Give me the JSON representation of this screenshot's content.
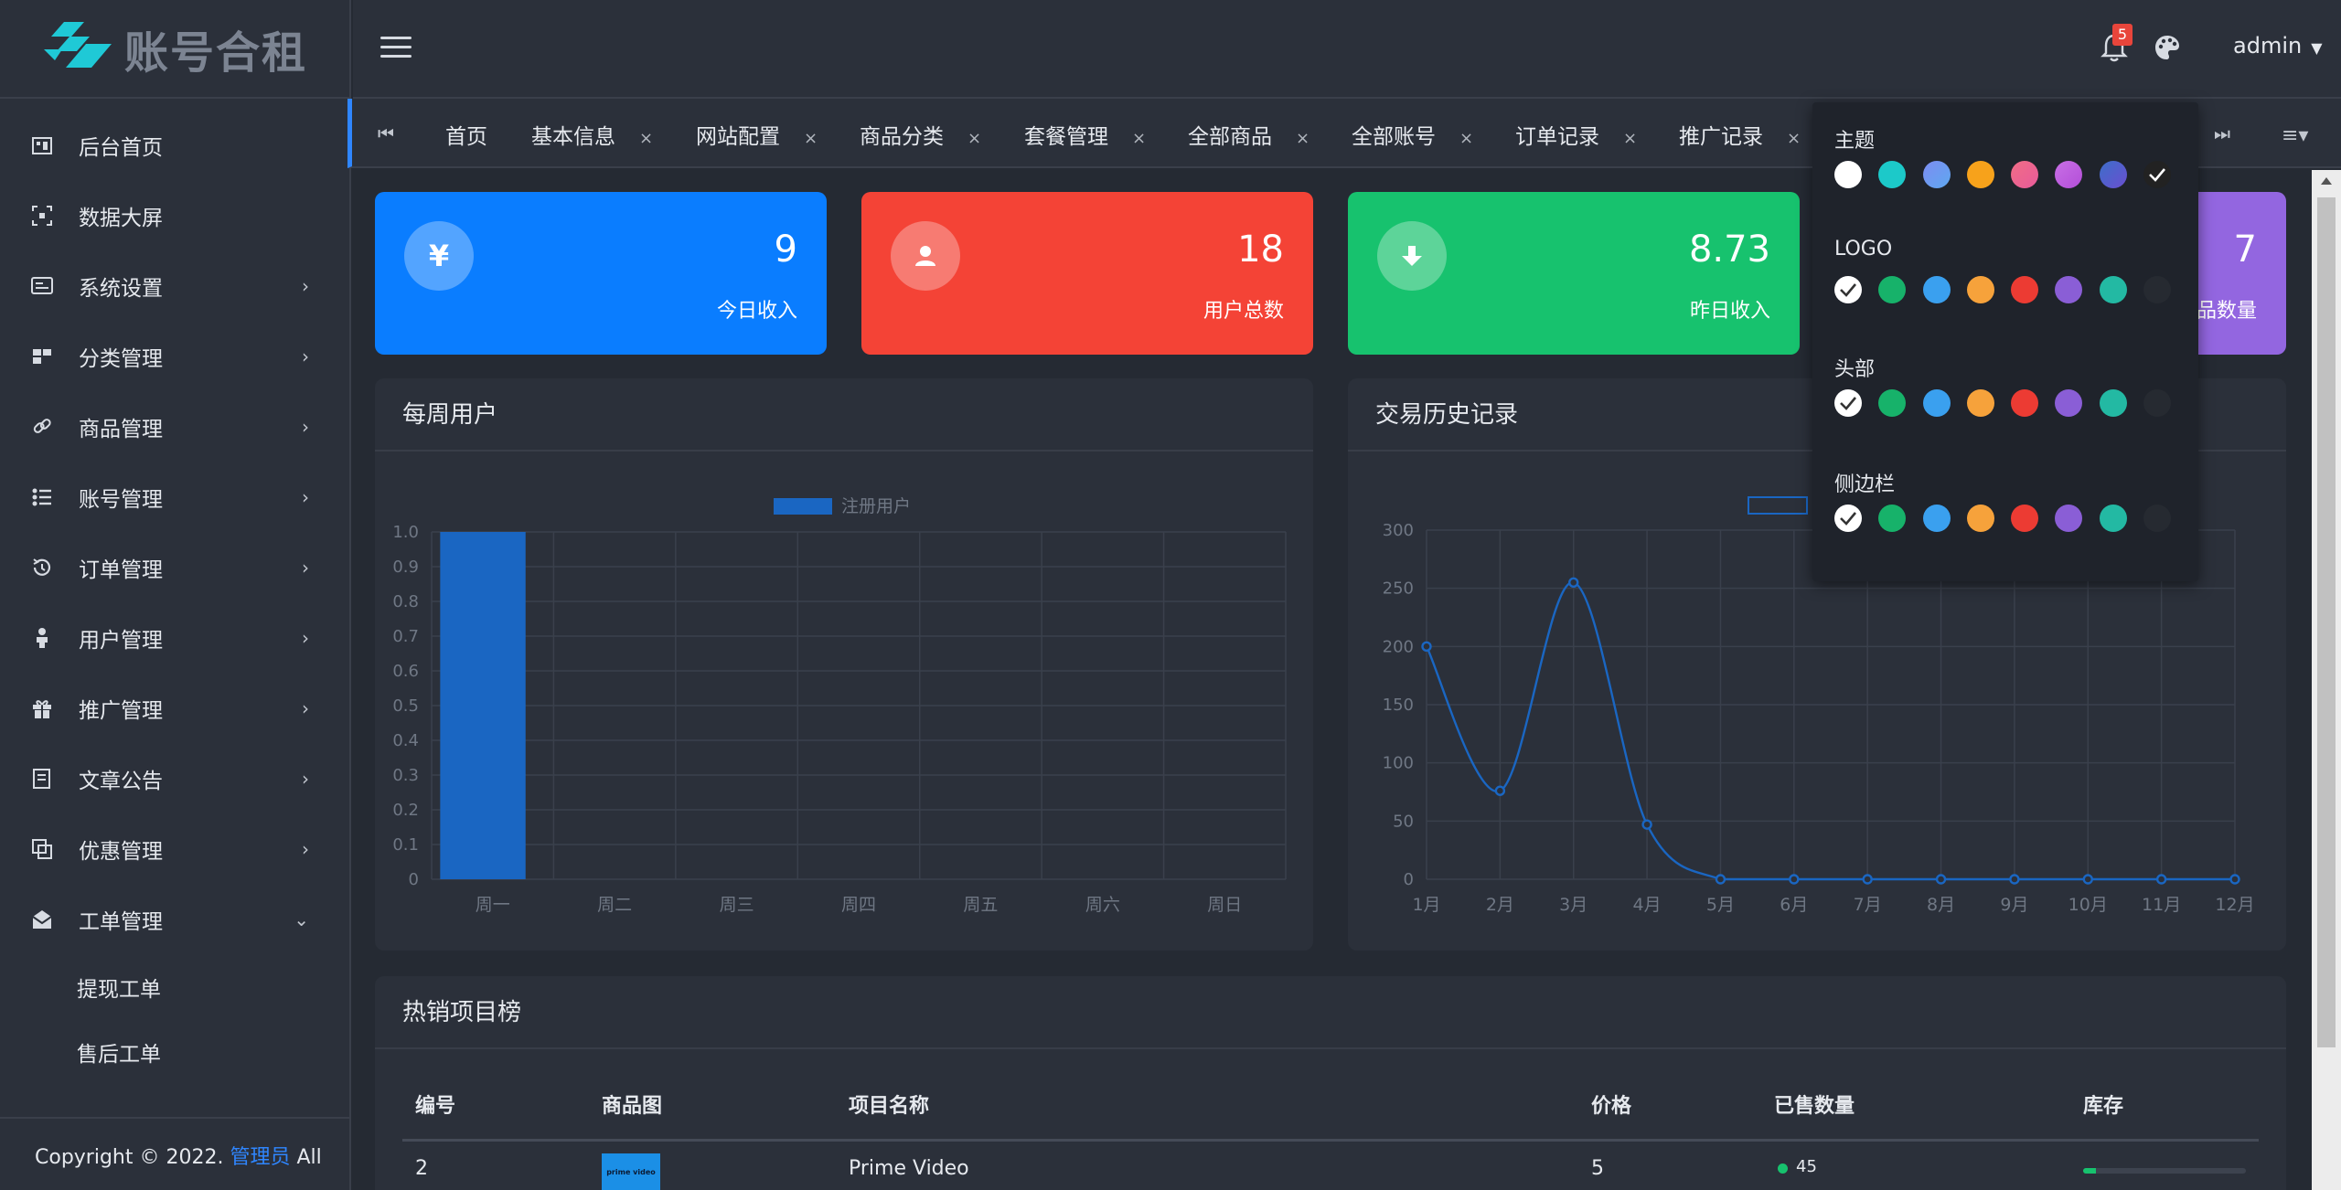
{
  "app": {
    "logo_text": "账号合租"
  },
  "sidebar": {
    "items": [
      {
        "label": "后台首页",
        "icon": "dashboard-icon",
        "arrow": ""
      },
      {
        "label": "数据大屏",
        "icon": "screen-icon",
        "arrow": ""
      },
      {
        "label": "系统设置",
        "icon": "settings-icon",
        "arrow": "›"
      },
      {
        "label": "分类管理",
        "icon": "category-icon",
        "arrow": "›"
      },
      {
        "label": "商品管理",
        "icon": "link-icon",
        "arrow": "›"
      },
      {
        "label": "账号管理",
        "icon": "list-icon",
        "arrow": "›"
      },
      {
        "label": "订单管理",
        "icon": "history-icon",
        "arrow": "›"
      },
      {
        "label": "用户管理",
        "icon": "user-icon",
        "arrow": "›"
      },
      {
        "label": "推广管理",
        "icon": "gift-icon",
        "arrow": "›"
      },
      {
        "label": "文章公告",
        "icon": "article-icon",
        "arrow": "›"
      },
      {
        "label": "优惠管理",
        "icon": "coupon-icon",
        "arrow": "›"
      },
      {
        "label": "工单管理",
        "icon": "mail-icon",
        "arrow": "⌄"
      }
    ],
    "subitems": [
      "提现工单",
      "售后工单"
    ],
    "copyright_prefix": "Copyright © 2022.",
    "copyright_link": "管理员",
    "copyright_suffix": "All"
  },
  "header": {
    "notification_count": "5",
    "username": "admin"
  },
  "tabs": [
    {
      "label": "首页",
      "closable": false
    },
    {
      "label": "基本信息",
      "closable": true
    },
    {
      "label": "网站配置",
      "closable": true
    },
    {
      "label": "商品分类",
      "closable": true
    },
    {
      "label": "套餐管理",
      "closable": true
    },
    {
      "label": "全部商品",
      "closable": true
    },
    {
      "label": "全部账号",
      "closable": true
    },
    {
      "label": "订单记录",
      "closable": true
    },
    {
      "label": "推广记录",
      "closable": true
    }
  ],
  "tab_close_glyph": "×",
  "stats": [
    {
      "value": "9",
      "label": "今日收入",
      "icon": "yen-icon",
      "glyph": "¥",
      "color": "#0a7dff"
    },
    {
      "value": "18",
      "label": "用户总数",
      "icon": "user-icon",
      "glyph": "",
      "color": "#f44336"
    },
    {
      "value": "8.73",
      "label": "昨日收入",
      "icon": "download-icon",
      "glyph": "",
      "color": "#17c26e"
    },
    {
      "value": "7",
      "label": "品数量",
      "icon": "box-icon",
      "glyph": "",
      "color": "#9366e0"
    }
  ],
  "weekly_panel": {
    "title": "每周用户"
  },
  "history_panel": {
    "title": "交易历史记录"
  },
  "hot_panel": {
    "title": "热销项目榜"
  },
  "theme_popup": {
    "sections": [
      "主题",
      "LOGO",
      "头部",
      "侧边栏"
    ],
    "theme_colors": [
      "#ffffff",
      "#1cc9c9",
      "#7d8cf2",
      "#f7a21b",
      "#f16d86",
      "#c86fe6",
      "#3d6ec9",
      "#222222"
    ],
    "other_colors": [
      "#ffffff",
      "#17b26a",
      "#3aa0ef",
      "#f6a23b",
      "#ec3b33",
      "#8a5ed6",
      "#23b9a3",
      "#262a31"
    ]
  },
  "chart_data": [
    {
      "type": "bar",
      "title": "",
      "categories": [
        "周一",
        "周二",
        "周三",
        "周四",
        "周五",
        "周六",
        "周日"
      ],
      "series": [
        {
          "name": "注册用户",
          "values": [
            1,
            0,
            0,
            0,
            0,
            0,
            0
          ]
        }
      ],
      "ylim": [
        0,
        1.0
      ],
      "yticks": [
        "0",
        "0.1",
        "0.2",
        "0.3",
        "0.4",
        "0.5",
        "0.6",
        "0.7",
        "0.8",
        "0.9",
        "1.0"
      ],
      "grid": true,
      "legend": "top-center",
      "color": "#1a66c2"
    },
    {
      "type": "line",
      "title": "",
      "categories": [
        "1月",
        "2月",
        "3月",
        "4月",
        "5月",
        "6月",
        "7月",
        "8月",
        "9月",
        "10月",
        "11月",
        "12月"
      ],
      "series": [
        {
          "values": [
            200,
            76,
            255,
            47,
            0,
            0,
            0,
            0,
            0,
            0,
            0,
            0
          ]
        }
      ],
      "ylim": [
        0,
        300
      ],
      "yticks": [
        "0",
        "50",
        "100",
        "150",
        "200",
        "250",
        "300"
      ],
      "grid": true,
      "legend": "top-center",
      "color": "#1a66c2"
    }
  ],
  "table": {
    "headers": [
      "编号",
      "商品图",
      "项目名称",
      "价格",
      "已售数量",
      "库存"
    ],
    "rows": [
      {
        "id": "2",
        "image_text": "prime video",
        "name": "Prime Video",
        "price": "5",
        "sold": "45",
        "stock_fraction": 0.08
      }
    ]
  }
}
